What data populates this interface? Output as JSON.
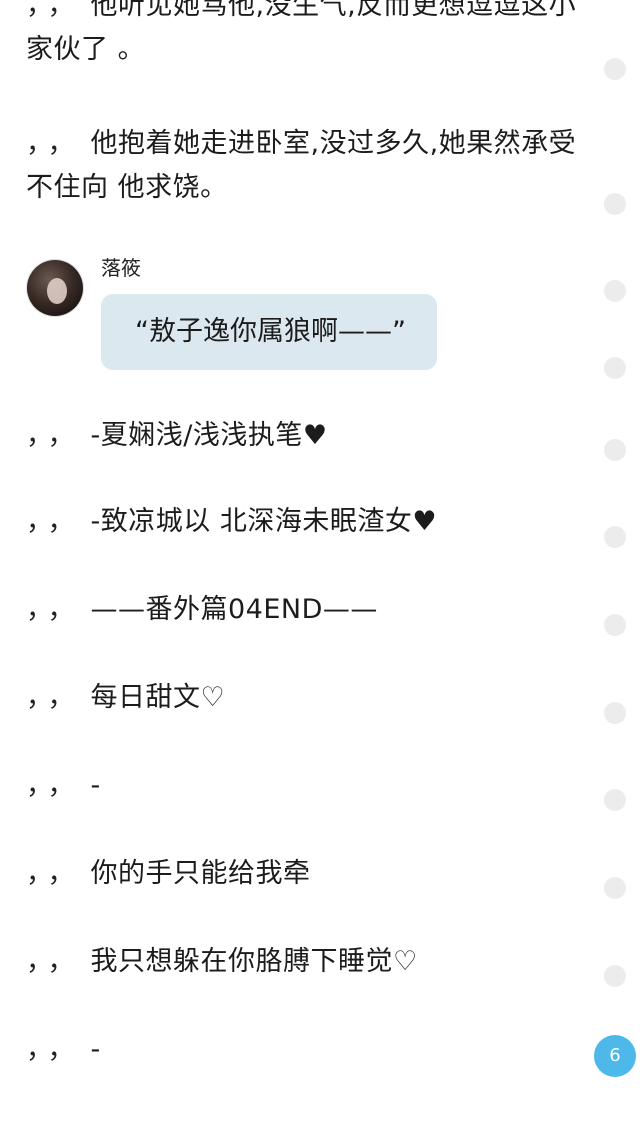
{
  "content": {
    "line_prefix": "，，",
    "paragraphs": [
      {
        "text": "他听见她骂他,没生气,反而更想逗逗这小家伙了 。"
      },
      {
        "text": "他抱着她走进卧室,没过多久,她果然承受不住向 他求饶。"
      }
    ],
    "message": {
      "speaker": "落筱",
      "bubble_text": "“敖子逸你属狼啊——”"
    },
    "lines": [
      {
        "text": "-夏娴浅/浅浅执笔♥"
      },
      {
        "text": "-致凉城以 北深海未眠渣女♥"
      },
      {
        "text": "——番外篇04END——"
      },
      {
        "text": "每日甜文♡"
      },
      {
        "text": "-"
      },
      {
        "text": "你的手只能给我牵"
      },
      {
        "text": "我只想躲在你胳膊下睡觉♡"
      },
      {
        "text": "-"
      }
    ]
  },
  "floating": {
    "comment_count": "6",
    "accent_color": "#4eb8ea"
  },
  "colors": {
    "bubble_bg": "#dce8ef",
    "dot": "#ececec",
    "text": "#1c1c1c"
  },
  "icons": {
    "paragraph_marker": "circle-dot-icon",
    "comment": "comment-bubble-icon"
  }
}
